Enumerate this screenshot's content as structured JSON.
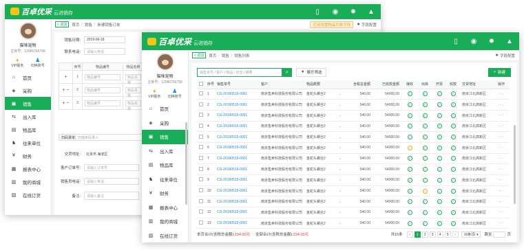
{
  "brand": {
    "name": "百卓优采",
    "tagline": "云进销存"
  },
  "topbar_icons": [
    "phone-icon",
    "support-icon",
    "gear-icon",
    "bell-icon"
  ],
  "user": {
    "name": "猫咪宠物",
    "id": "主账号：12086766799"
  },
  "user_actions": [
    {
      "icon": "vip-icon",
      "label": "VIP服务"
    },
    {
      "icon": "switch-account-icon",
      "label": "切换账号"
    }
  ],
  "menu": [
    {
      "icon": "home-icon",
      "label": "首页"
    },
    {
      "icon": "purchase-icon",
      "label": "采购"
    },
    {
      "icon": "sales-icon",
      "label": "销售"
    },
    {
      "icon": "inout-icon",
      "label": "出入库"
    },
    {
      "icon": "goods-icon",
      "label": "物品库"
    },
    {
      "icon": "partner-icon",
      "label": "往来单位"
    },
    {
      "icon": "finance-icon",
      "label": "财务"
    },
    {
      "icon": "report-icon",
      "label": "报表中心"
    },
    {
      "icon": "shop-icon",
      "label": "我的商城"
    },
    {
      "icon": "order-icon",
      "label": "在线订货"
    }
  ],
  "back_window": {
    "back_label": "返回",
    "crumbs": [
      "首页",
      "销售",
      "新建销售订单"
    ],
    "warn": "应用设置物品列表字段",
    "field_config": "字段配置",
    "form": {
      "date_label": "销售日期:",
      "date_value": "2019-06-18",
      "phone_label": "联系电话:",
      "phone_placeholder": "请输入电话"
    },
    "grid_headers": [
      "序号",
      "物品编号",
      "物品名称"
    ],
    "grid_rows": [
      {
        "ops": "+",
        "no": "1",
        "placeholder": "物品编号",
        "name_ph": "物品名称"
      },
      {
        "ops": "+ −",
        "no": "2",
        "placeholder": "物品编号",
        "name_ph": "物品名称"
      },
      {
        "ops": "+ −",
        "no": "3",
        "placeholder": "物品编号",
        "name_ph": "物品名称"
      }
    ],
    "scan_label": "扫码录单",
    "scan_placeholder": "扫描条码录入",
    "address_label": "交货地址:",
    "address_value": "北京市 海淀区",
    "cust_order_label": "客户订单号:",
    "cust_order_ph": "请输入订单号",
    "sales_phone_label": "销售员电话:",
    "sales_phone_ph": "请输入电话",
    "remark_label": "备注:",
    "remark_ph": "请输入备注"
  },
  "front_window": {
    "back_label": "返回",
    "crumbs": [
      "首页",
      "销售",
      "销售列表"
    ],
    "field_config": "字段配置",
    "search_placeholder": "销售单号 / 客户 / 物品 / 状态 / 摘要",
    "filter_label": "展开筛选",
    "new_label": "新建",
    "headers": [
      "",
      "序号",
      "销售单号",
      "客户",
      "物品概要",
      "",
      "含税总金额",
      "已收款金额",
      "接收",
      "出库",
      "开票",
      "收款",
      "交货地址",
      "操作"
    ],
    "rows": [
      {
        "no": "1",
        "order": "CG-20190515-0001",
        "customer": "南京售卖科技股份有限公司",
        "summary": "金蛇头螺丝2",
        "total": "540.00",
        "received": "54000.00",
        "status": [
          "ok",
          "ok",
          "ok",
          "ok"
        ],
        "address": "南京江北高新区"
      },
      {
        "no": "2",
        "order": "CG-20190515-0001",
        "customer": "南京售卖科技股份有限公司",
        "summary": "金蛇头螺丝2",
        "total": "540.00",
        "received": "54000.00",
        "status": [
          "ok",
          "ok",
          "ok",
          "ok"
        ],
        "address": "南京江北高新区"
      },
      {
        "no": "3",
        "order": "CG-20190515-0001",
        "customer": "南京售卖科技股份有限公司",
        "summary": "金蛇头螺丝2",
        "total": "540.00",
        "received": "54000.00",
        "status": [
          "ok",
          "ok",
          "ok",
          "ok"
        ],
        "address": "南京江北高新区"
      },
      {
        "no": "4",
        "order": "CG-20190515-0001",
        "customer": "南京售卖科技股份有限公司",
        "summary": "金蛇头螺丝2",
        "total": "540.00",
        "received": "54000.00",
        "status": [
          "ok",
          "ok",
          "ok",
          "ok"
        ],
        "address": "南京江北高新区"
      },
      {
        "no": "5",
        "order": "CG-20190515-0001",
        "customer": "南京售卖科技股份有限公司",
        "summary": "金蛇头螺丝2",
        "total": "540.00",
        "received": "54000.00",
        "status": [
          "ok",
          "ok",
          "ok",
          "ok"
        ],
        "address": "南京江北高新区"
      },
      {
        "no": "6",
        "order": "CG-20190515-0001",
        "customer": "南京售卖科技股份有限公司",
        "summary": "金蛇头螺丝2",
        "total": "540.00",
        "received": "54000.00",
        "status": [
          "pend",
          "ok",
          "ok",
          "ok"
        ],
        "address": "南京江北高新区"
      },
      {
        "no": "7",
        "order": "CG-20190515-0001",
        "customer": "南京售卖科技股份有限公司",
        "summary": "金蛇头螺丝2",
        "total": "540.00",
        "received": "54000.00",
        "status": [
          "ok",
          "ok",
          "ok",
          "ok"
        ],
        "address": "南京江北高新区"
      },
      {
        "no": "8",
        "order": "CG-20190515-0001",
        "customer": "南京售卖科技股份有限公司",
        "summary": "金蛇头螺丝2",
        "total": "540.00",
        "received": "54000.00",
        "status": [
          "ok",
          "ok",
          "ok",
          "ok"
        ],
        "address": "南京江北高新区"
      },
      {
        "no": "9",
        "order": "CG-20190515-0001",
        "customer": "南京售卖科技股份有限公司",
        "summary": "金蛇头螺丝2",
        "total": "540.00",
        "received": "54000.00",
        "status": [
          "ok",
          "ok",
          "ok",
          "ok"
        ],
        "address": "南京江北高新区"
      },
      {
        "no": "10",
        "order": "CG-20190515-0001",
        "customer": "南京售卖科技股份有限公司",
        "summary": "金蛇头螺丝2",
        "total": "540.00",
        "received": "54000.00",
        "status": [
          "ok",
          "pend",
          "ok",
          "ok"
        ],
        "address": "南京江北高新区"
      },
      {
        "no": "11",
        "order": "CG-20190515-0001",
        "customer": "南京售卖科技股份有限公司",
        "summary": "金蛇头螺丝2",
        "total": "540.00",
        "received": "54000.00",
        "status": [
          "ok",
          "ok",
          "ok",
          "ok"
        ],
        "address": "南京江北高新区"
      },
      {
        "no": "12",
        "order": "CG-20190515-0001",
        "customer": "南京售卖科技股份有限公司",
        "summary": "金蛇头螺丝2",
        "total": "540.00",
        "received": "54000.00",
        "status": [
          "ok",
          "ok",
          "ok",
          "ok"
        ],
        "address": "南京江北高新区"
      },
      {
        "no": "13",
        "order": "CG-20190515-0001",
        "customer": "南京售卖科技股份有限公司",
        "summary": "金蛇头螺丝2",
        "total": "540.00",
        "received": "54000.00",
        "status": [
          "ok",
          "ok",
          "ok",
          "ok"
        ],
        "address": "南京江北高新区"
      }
    ],
    "pager": {
      "page_total_label": "本页合计(含税总金额):",
      "page_total": "234.00元",
      "all_total_label": "全部合计(含税总金额):",
      "all_total": "234.00元",
      "count": "共15条",
      "pages": [
        "1",
        "2",
        "3",
        "4",
        "5"
      ],
      "current": "1",
      "page_size": "16条/页",
      "goto_label": "跳至",
      "page_unit": "页"
    }
  },
  "colors": {
    "brand": "#1aad57",
    "link": "#1e88e5",
    "warn": "#f5a623",
    "danger": "#e53935"
  }
}
